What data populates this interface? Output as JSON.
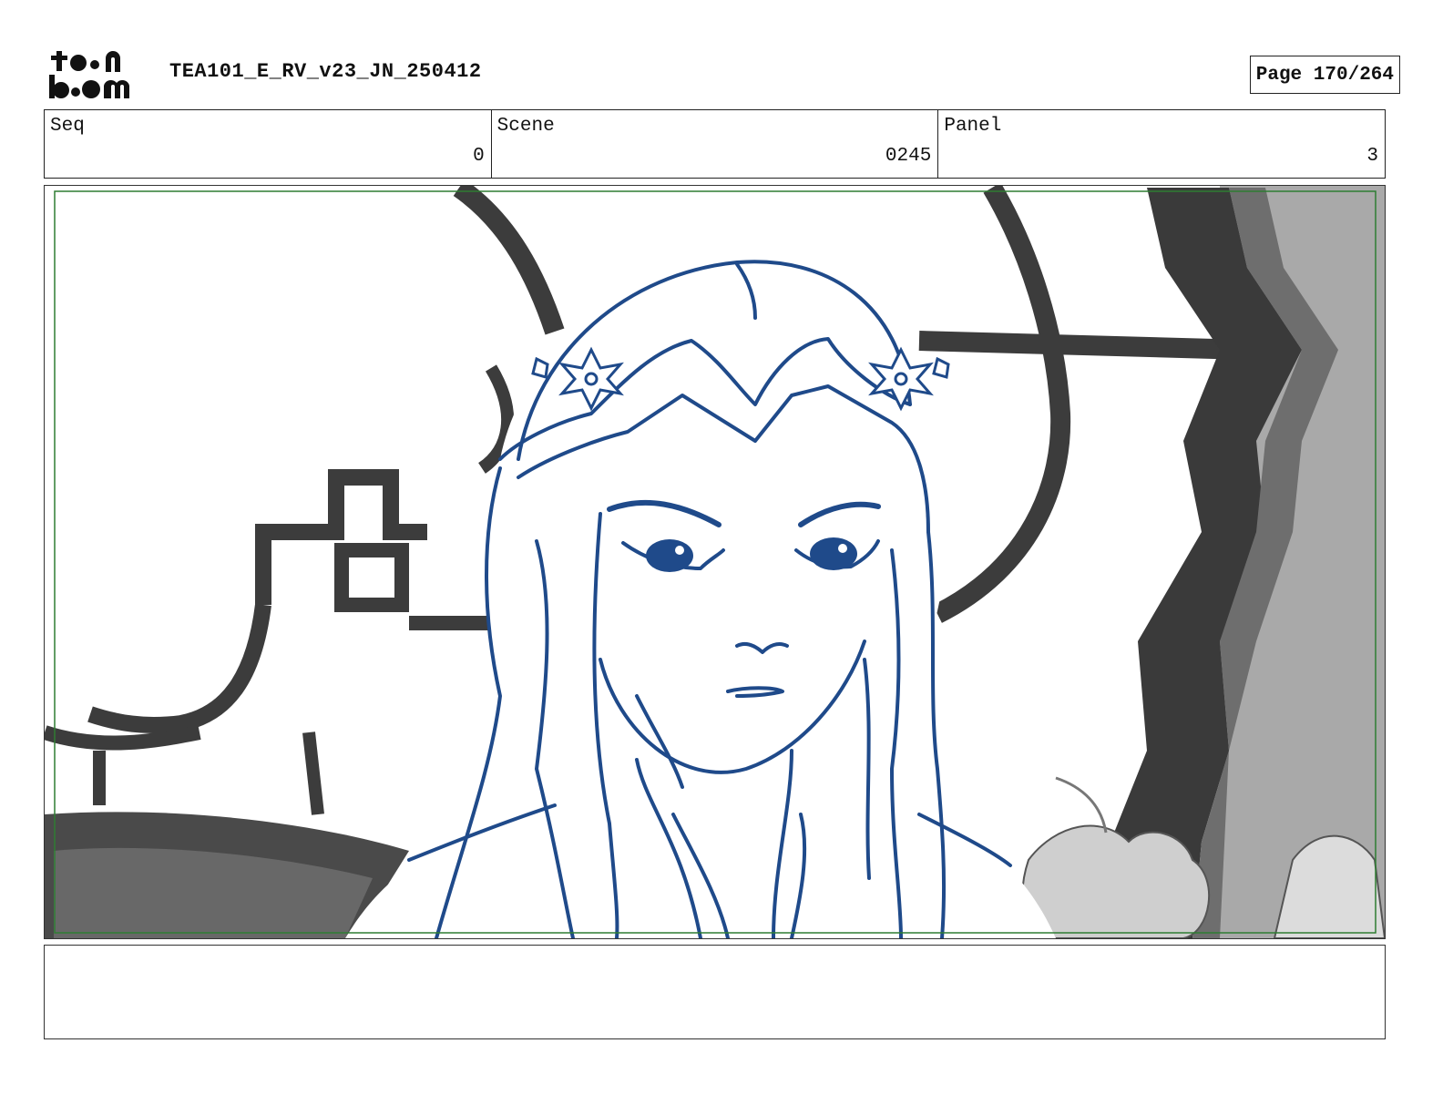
{
  "header": {
    "logo_text": "toon boom",
    "document_title": "TEA101_E_RV_v23_JN_250412",
    "page_label": "Page",
    "page_number": "170/264"
  },
  "info": {
    "seq_label": "Seq",
    "seq_value": "0",
    "scene_label": "Scene",
    "scene_value": "0245",
    "panel_label": "Panel",
    "panel_value": "3"
  },
  "colors": {
    "sketch_line": "#1f4a8a",
    "background_dark": "#3a3a3a",
    "background_mid": "#a8a8a8",
    "safe_frame": "#2e7d32"
  },
  "notes": {
    "action_text": ""
  }
}
